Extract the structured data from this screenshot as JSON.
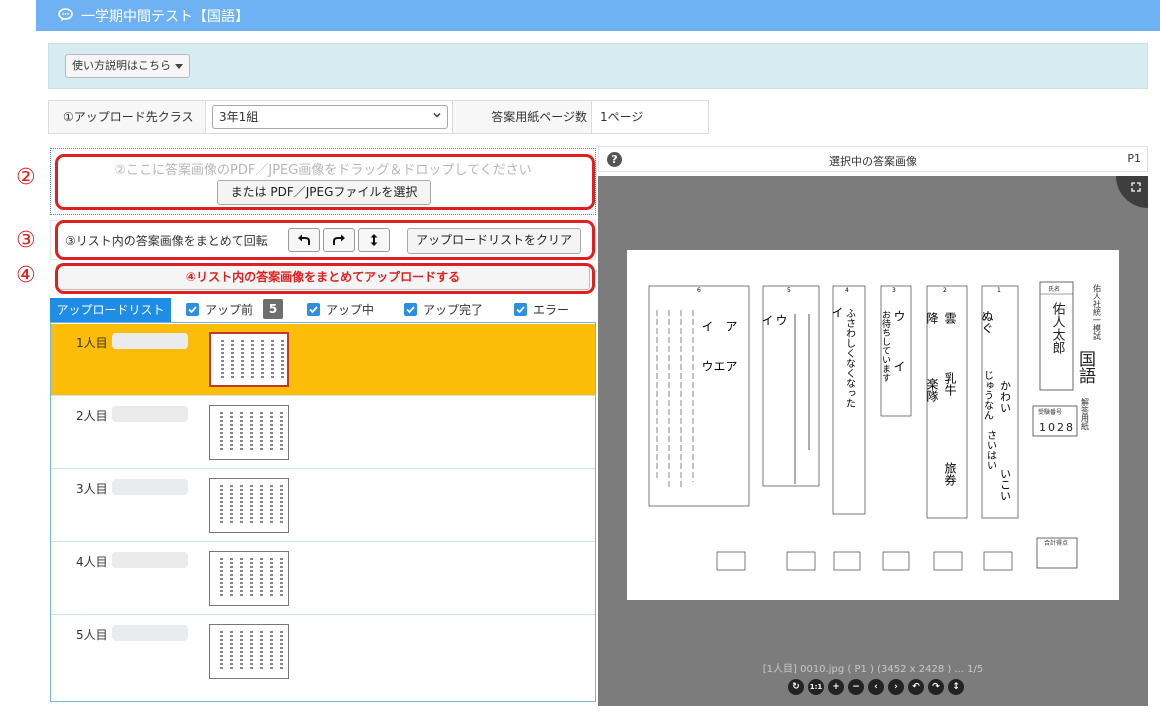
{
  "header": {
    "title": "一学期中間テスト【国語】",
    "icon": "chat-bubble-icon"
  },
  "help": {
    "button_label": "使い方説明はこちら"
  },
  "settings": {
    "class_label": "①アップロード先クラス",
    "class_value": "3年1組",
    "pages_label": "答案用紙ページ数",
    "pages_value": "1ページ"
  },
  "step2": {
    "number": "②",
    "dropzone_text": "②ここに答案画像のPDF／JPEG画像をドラッグ＆ドロップしてください",
    "select_button": "または PDF／JPEGファイルを選択"
  },
  "step3": {
    "number": "③",
    "label": "③リスト内の答案画像をまとめて回転",
    "clear_button": "アップロードリストをクリア"
  },
  "step4": {
    "number": "④",
    "button": "④リスト内の答案画像をまとめてアップロードする"
  },
  "list": {
    "tab_label": "アップロードリスト",
    "filters": [
      {
        "label": "アップ前",
        "checked": true
      },
      {
        "label": "アップ中",
        "checked": true
      },
      {
        "label": "アップ完了",
        "checked": true
      },
      {
        "label": "エラー",
        "checked": true
      }
    ],
    "before_count": "5",
    "rows": [
      {
        "name": "1人目",
        "selected": true
      },
      {
        "name": "2人目",
        "selected": false
      },
      {
        "name": "3人目",
        "selected": false
      },
      {
        "name": "4人目",
        "selected": false
      },
      {
        "name": "5人目",
        "selected": false
      }
    ]
  },
  "viewer": {
    "title": "選択中の答案画像",
    "page": "P1",
    "caption": "[1人目] 0010.jpg ( P1 ) (3452 x 2428 ) ... 1/5",
    "sheet": {
      "school": "佑人社統一模試",
      "subject": "国語",
      "doc": "解答用紙",
      "name_label": "氏名",
      "student_name": "佑人太郎",
      "exam_no_label": "受験番号",
      "exam_no": "1028",
      "total_label": "合計得点",
      "sections": [
        "1",
        "2",
        "3",
        "4",
        "5",
        "6"
      ],
      "answers": [
        "ぬぐ",
        "じゅうなん",
        "かわい",
        "さいはい",
        "いこい",
        "雲",
        "乳牛",
        "降",
        "楽隊",
        "旅券",
        "ウ",
        "イ",
        "お待ちしています",
        "イ",
        "ふさわしくなくなった",
        "イ",
        "ウ",
        "ア",
        "イ",
        "ウ",
        "ア",
        "エ"
      ]
    },
    "colors": {
      "bg": "#7c7c7c",
      "accent": "#1f8ce6"
    }
  }
}
